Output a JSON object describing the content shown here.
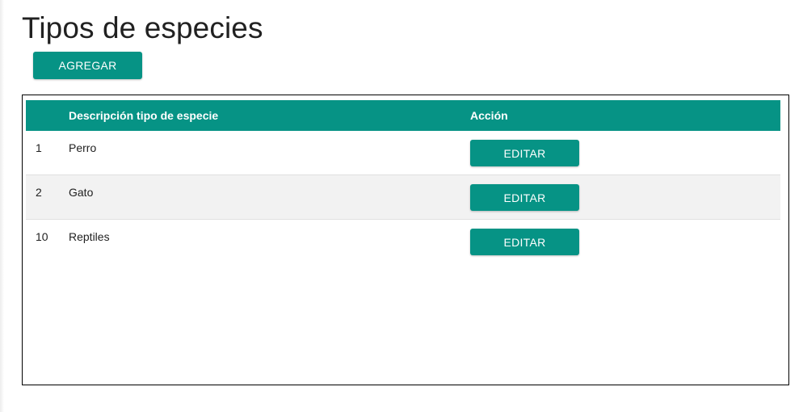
{
  "page": {
    "title": "Tipos de especies",
    "add_label": "AGREGAR"
  },
  "table": {
    "headers": {
      "id": "",
      "description": "Descripción tipo de especie",
      "action": "Acción"
    },
    "rows": [
      {
        "id": "1",
        "description": "Perro",
        "action_label": "EDITAR"
      },
      {
        "id": "2",
        "description": "Gato",
        "action_label": "EDITAR"
      },
      {
        "id": "10",
        "description": "Reptiles",
        "action_label": "EDITAR"
      }
    ]
  },
  "colors": {
    "accent": "#069385",
    "stripe": "#f2f2f2",
    "text": "#212121"
  }
}
